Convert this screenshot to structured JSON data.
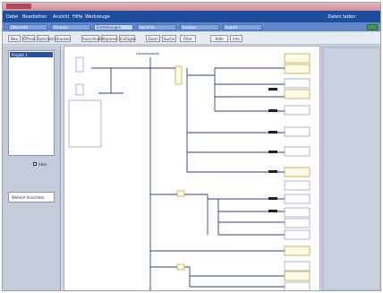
{
  "menubar": {
    "items": [
      "Datei",
      "Bearbeiten",
      "Ansicht",
      "Hilfe",
      "Werkzeuge"
    ],
    "user": "Daten laden"
  },
  "tabs": [
    {
      "label": "Übersicht"
    },
    {
      "label": "Struktur"
    },
    {
      "label": "Einstellungen"
    },
    {
      "label": "Berichte"
    },
    {
      "label": "Analyse"
    },
    {
      "label": "Export"
    }
  ],
  "toolbar": {
    "buttons": [
      "Neu",
      "Öffnen",
      "Speichern",
      "Drucken",
      "Ausschneiden",
      "Kopieren",
      "Einfügen",
      "Zoom",
      "Suche",
      "Filter",
      "Hilfe",
      "Info"
    ]
  },
  "sidebar": {
    "list_selected": "Projekt 1",
    "check_label": "Alles",
    "section_label": "Weitere Ansichten"
  },
  "canvas": {
    "header": "Gesamtprojekt"
  }
}
